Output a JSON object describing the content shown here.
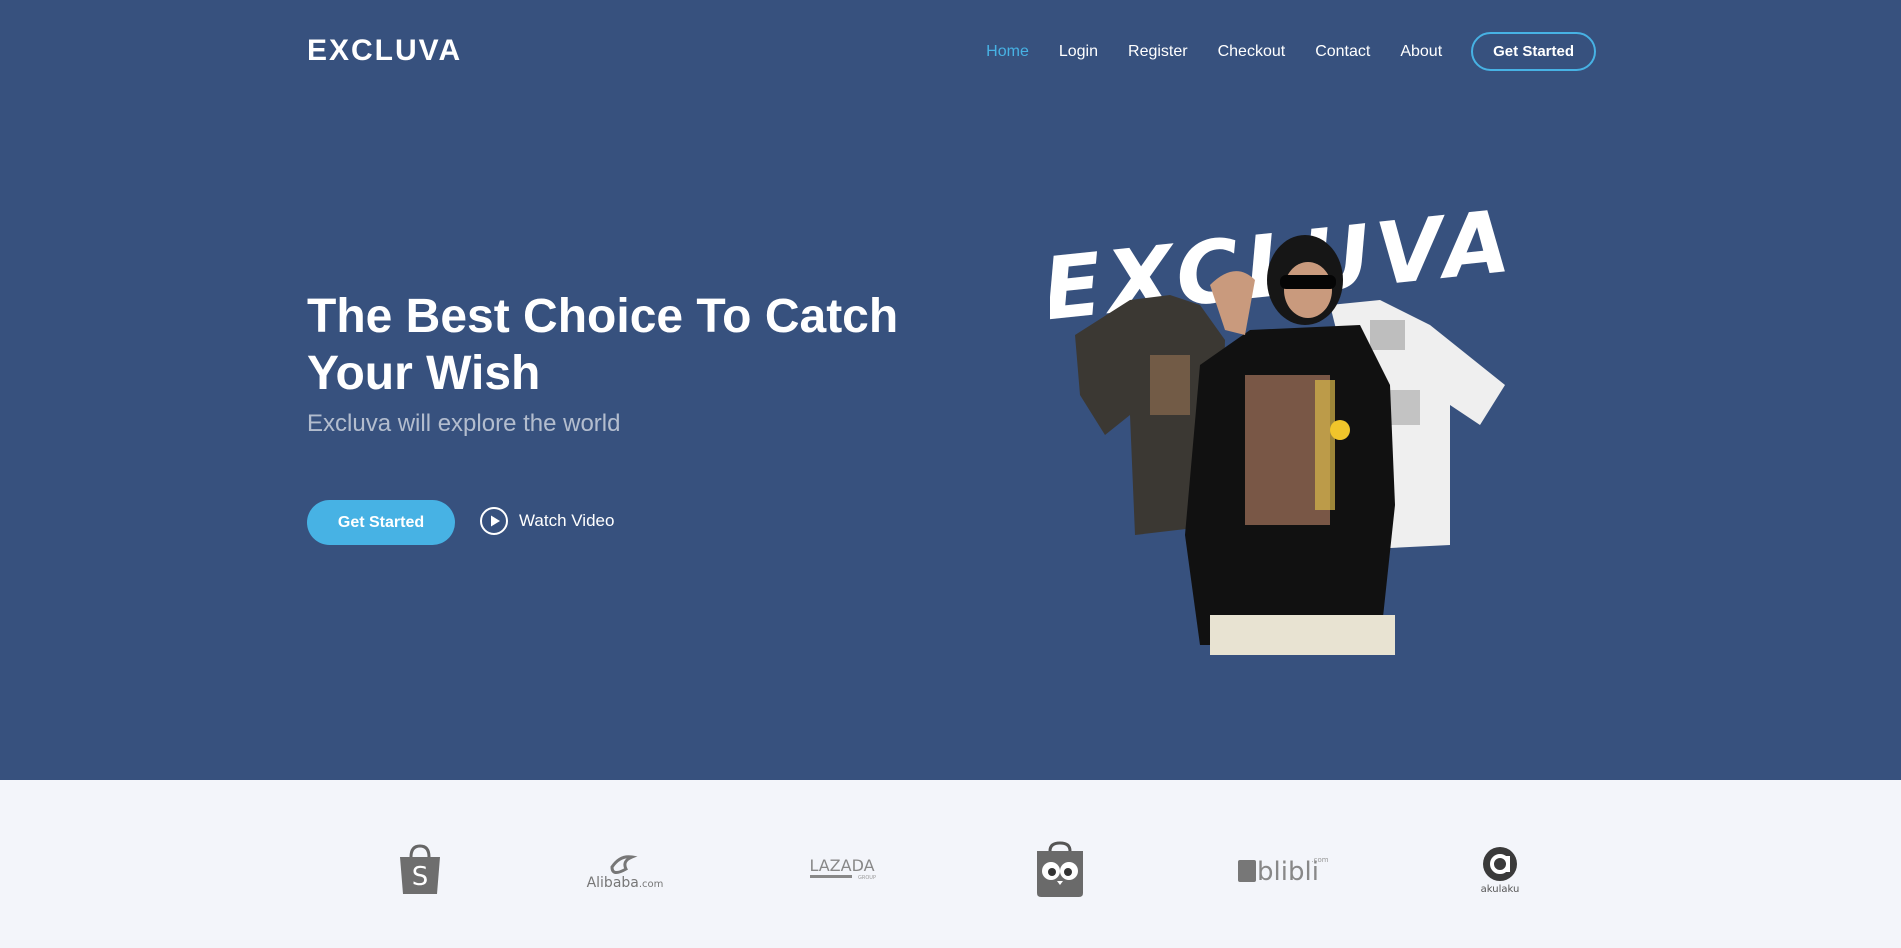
{
  "brand": {
    "name": "EXCLUVA"
  },
  "nav": {
    "items": [
      {
        "label": "Home",
        "active": true
      },
      {
        "label": "Login",
        "active": false
      },
      {
        "label": "Register",
        "active": false
      },
      {
        "label": "Checkout",
        "active": false
      },
      {
        "label": "Contact",
        "active": false
      },
      {
        "label": "About",
        "active": false
      }
    ],
    "cta_label": "Get Started"
  },
  "hero": {
    "title": "The Best Choice To Catch Your Wish",
    "subtitle": "Excluva will explore the world",
    "primary_button": "Get Started",
    "video_link": "Watch Video",
    "art_lettering": "EXCLUVA"
  },
  "partners": {
    "logos": [
      {
        "name": "Shopee",
        "icon": "shopee-logo"
      },
      {
        "name": "Alibaba.com",
        "icon": "alibaba-logo"
      },
      {
        "name": "LAZADA",
        "icon": "lazada-logo"
      },
      {
        "name": "Tokopedia",
        "icon": "tokopedia-logo"
      },
      {
        "name": "blibli.com",
        "icon": "blibli-logo"
      },
      {
        "name": "akulaku",
        "icon": "akulaku-logo"
      }
    ]
  },
  "colors": {
    "hero_background": "#37517e",
    "accent": "#47b2e4",
    "partners_background": "#f3f5fa"
  }
}
